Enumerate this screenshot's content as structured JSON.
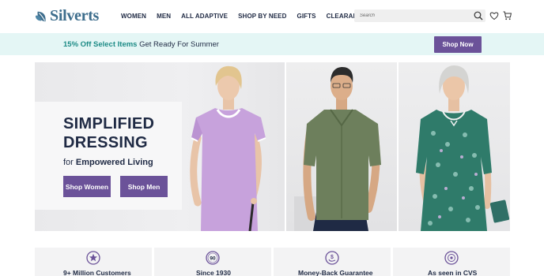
{
  "header": {
    "logo_text": "Silverts",
    "nav": [
      "WOMEN",
      "MEN",
      "ALL ADAPTIVE",
      "SHOP BY NEED",
      "GIFTS",
      "CLEARANCE"
    ],
    "search_placeholder": "Search"
  },
  "promo": {
    "highlight": "15% Off Select Items",
    "text": " Get Ready For Summer",
    "button": "Shop Now"
  },
  "hero": {
    "title": "SIMPLIFIED DRESSING",
    "subtitle_prefix": "for ",
    "subtitle_bold": "Empowered Living",
    "buttons": [
      "Shop Women",
      "Shop Men"
    ]
  },
  "trust": [
    {
      "label": "9+ Million Customers",
      "icon": "star-badge-icon"
    },
    {
      "label": "Since 1930",
      "icon": "90-badge-icon"
    },
    {
      "label": "Money-Back Guarantee",
      "icon": "money-back-icon"
    },
    {
      "label": "As seen in CVS",
      "icon": "cvs-badge-icon"
    }
  ],
  "colors": {
    "brand_purple": "#6b5299",
    "promo_bg": "#e4f6f5",
    "promo_teal": "#1d8b86",
    "logo_blue": "#3d6d8c",
    "navy_text": "#1f2a44"
  }
}
